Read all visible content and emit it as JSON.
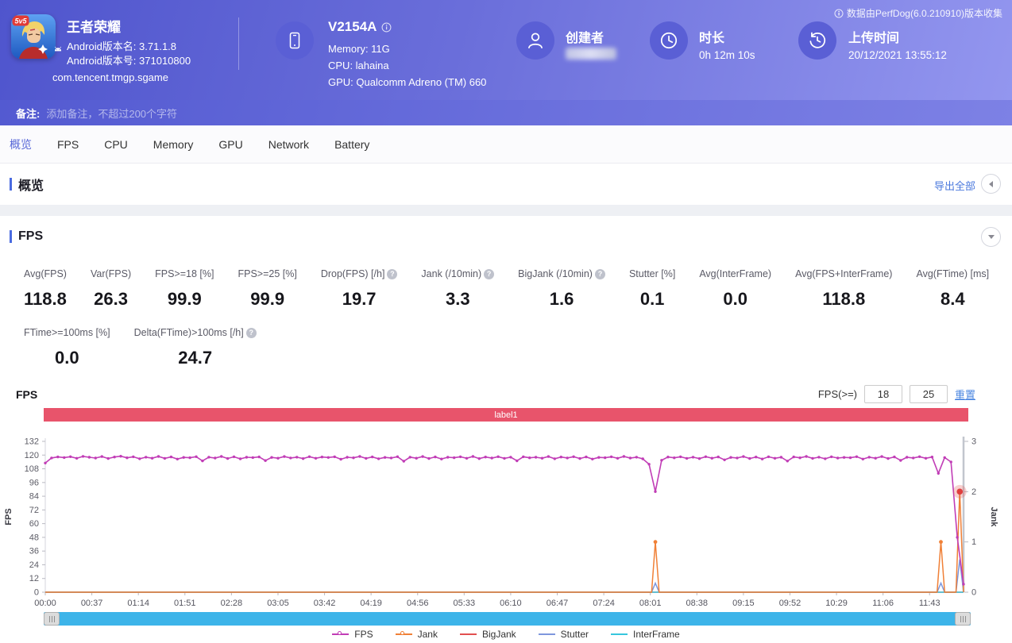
{
  "header": {
    "app": {
      "name": "王者荣耀",
      "badge": "5v5",
      "version_name": "Android版本名: 3.71.1.8",
      "version_code": "Android版本号: 371010800",
      "package": "com.tencent.tmgp.sgame"
    },
    "device": {
      "model": "V2154A",
      "memory": "Memory: 11G",
      "cpu": "CPU: lahaina",
      "gpu": "GPU: Qualcomm Adreno (TM) 660"
    },
    "creator": {
      "label": "创建者",
      "value_hidden": true
    },
    "duration": {
      "label": "时长",
      "value": "0h 12m 10s"
    },
    "upload": {
      "label": "上传时间",
      "value": "20/12/2021 13:55:12"
    },
    "collected_by": "数据由PerfDog(6.0.210910)版本收集"
  },
  "icons": {
    "platform": "android-icon",
    "device": "phone-icon",
    "creator": "user-icon",
    "duration": "clock-icon",
    "upload": "history-clock-icon",
    "info": "info-icon",
    "help": "question-icon",
    "overview_collapse": "chevron-left-icon",
    "fps_collapse": "chevron-down-icon"
  },
  "remark": {
    "label": "备注:",
    "placeholder": "添加备注，不超过200个字符"
  },
  "tabs": [
    {
      "label": "概览",
      "active": true
    },
    {
      "label": "FPS",
      "active": false
    },
    {
      "label": "CPU",
      "active": false
    },
    {
      "label": "Memory",
      "active": false
    },
    {
      "label": "GPU",
      "active": false
    },
    {
      "label": "Network",
      "active": false
    },
    {
      "label": "Battery",
      "active": false
    }
  ],
  "overview": {
    "title": "概览",
    "export_all": "导出全部"
  },
  "fps_section": {
    "title": "FPS",
    "chart_title": "FPS",
    "metrics_row1": [
      {
        "label": "Avg(FPS)",
        "value": "118.8",
        "help": false
      },
      {
        "label": "Var(FPS)",
        "value": "26.3",
        "help": false
      },
      {
        "label": "FPS>=18 [%]",
        "value": "99.9",
        "help": false
      },
      {
        "label": "FPS>=25 [%]",
        "value": "99.9",
        "help": false
      },
      {
        "label": "Drop(FPS) [/h]",
        "value": "19.7",
        "help": true
      },
      {
        "label": "Jank (/10min)",
        "value": "3.3",
        "help": true
      },
      {
        "label": "BigJank (/10min)",
        "value": "1.6",
        "help": true
      },
      {
        "label": "Stutter [%]",
        "value": "0.1",
        "help": false
      },
      {
        "label": "Avg(InterFrame)",
        "value": "0.0",
        "help": false
      },
      {
        "label": "Avg(FPS+InterFrame)",
        "value": "118.8",
        "help": false
      },
      {
        "label": "Avg(FTime) [ms]",
        "value": "8.4",
        "help": false
      }
    ],
    "metrics_row2": [
      {
        "label": "FTime>=100ms [%]",
        "value": "0.0",
        "help": false
      },
      {
        "label": "Delta(FTime)>100ms [/h]",
        "value": "24.7",
        "help": true
      }
    ],
    "threshold": {
      "label": "FPS(>=)",
      "input1": "18",
      "input2": "25",
      "reset": "重置"
    },
    "banner": "label1"
  },
  "chart_data": {
    "type": "line",
    "title": "label1",
    "xlabel": "",
    "ylabel_left": "FPS",
    "ylabel_right": "Jank",
    "ylim_left": [
      0,
      132
    ],
    "yticks_left": [
      0,
      12,
      24,
      36,
      48,
      60,
      72,
      84,
      96,
      108,
      120,
      132
    ],
    "ylim_right": [
      0,
      3
    ],
    "yticks_right": [
      0,
      1,
      2,
      3
    ],
    "x_max_seconds": 730,
    "tick_interval_seconds": 37,
    "x_ticks": [
      "00:00",
      "00:37",
      "01:14",
      "01:51",
      "02:28",
      "03:05",
      "03:42",
      "04:19",
      "04:56",
      "05:33",
      "06:10",
      "06:47",
      "07:24",
      "08:01",
      "08:38",
      "09:15",
      "09:52",
      "10:29",
      "11:06",
      "11:43"
    ],
    "grid": false,
    "legend_position": "bottom",
    "fps_dt_seconds": 5,
    "series": [
      {
        "name": "FPS",
        "color": "#c13db6",
        "axis": "left",
        "marker": "ring",
        "values": [
          113,
          117.5,
          118.4,
          117.8,
          118.6,
          117.2,
          118.9,
          118.1,
          117.4,
          118.7,
          117,
          118.3,
          119,
          117.6,
          118.5,
          116.8,
          118.2,
          117.3,
          118.8,
          117.1,
          118.4,
          116.5,
          118,
          117.7,
          118.6,
          114.9,
          118.2,
          117.4,
          118.8,
          117,
          118.5,
          116.7,
          118.1,
          117.8,
          118.4,
          115.2,
          118,
          117.3,
          118.7,
          117.5,
          118.2,
          116.9,
          118.6,
          117.2,
          118.3,
          117.9,
          118.5,
          116.4,
          118.1,
          117.6,
          118.8,
          117.1,
          118.4,
          116.8,
          118,
          117.5,
          118.6,
          114.6,
          118.2,
          117.3,
          118.7,
          117,
          118.4,
          116.6,
          118.1,
          117.7,
          118.5,
          117.2,
          118.8,
          116.9,
          118.3,
          117.4,
          118.6,
          117.1,
          118.2,
          115,
          118.5,
          117.6,
          118.1,
          117.3,
          118.7,
          116.8,
          118.3,
          117.5,
          118.6,
          117,
          118.4,
          116.5,
          118,
          117.7,
          118.5,
          117.2,
          118.8,
          117.4,
          118.2,
          116.7,
          112,
          88,
          115.5,
          118.3,
          117.6,
          118.5,
          117.1,
          118.2,
          116.9,
          118.6,
          117.3,
          118.4,
          115.8,
          118,
          117.5,
          118.7,
          117,
          118.3,
          116.6,
          118.5,
          117.2,
          118.1,
          114.8,
          118.4,
          117.6,
          118.8,
          117.1,
          118.2,
          116.8,
          118.5,
          117.4,
          118,
          117.7,
          118.6,
          116.5,
          118.2,
          117.3,
          118.7,
          117,
          118.4,
          115.3,
          118.1,
          117.5,
          118.6,
          117.2,
          118.3,
          104,
          117.8,
          114,
          48,
          7
        ]
      },
      {
        "name": "Jank",
        "color": "#f08037",
        "axis": "right",
        "marker": "ring",
        "baseline": 0,
        "spikes": [
          {
            "t": 485,
            "v": 1
          },
          {
            "t": 712,
            "v": 1
          },
          {
            "t": 727,
            "v": 2
          }
        ]
      },
      {
        "name": "BigJank",
        "color": "#e25050",
        "axis": "right",
        "marker": "line",
        "baseline": 0,
        "spikes": []
      },
      {
        "name": "Stutter",
        "color": "#7e97dd",
        "axis": "right",
        "marker": "line",
        "baseline": 0,
        "spikes": [
          {
            "t": 485,
            "v": 0.18
          },
          {
            "t": 712,
            "v": 0.18
          },
          {
            "t": 727,
            "v": 0.65
          }
        ]
      },
      {
        "name": "InterFrame",
        "color": "#36c6dd",
        "axis": "left",
        "marker": "line",
        "baseline": 0,
        "spikes": []
      }
    ],
    "highlight_point": {
      "series": "Jank",
      "t": 727,
      "v": 2
    },
    "legend": [
      "FPS",
      "Jank",
      "BigJank",
      "Stutter",
      "InterFrame"
    ]
  }
}
